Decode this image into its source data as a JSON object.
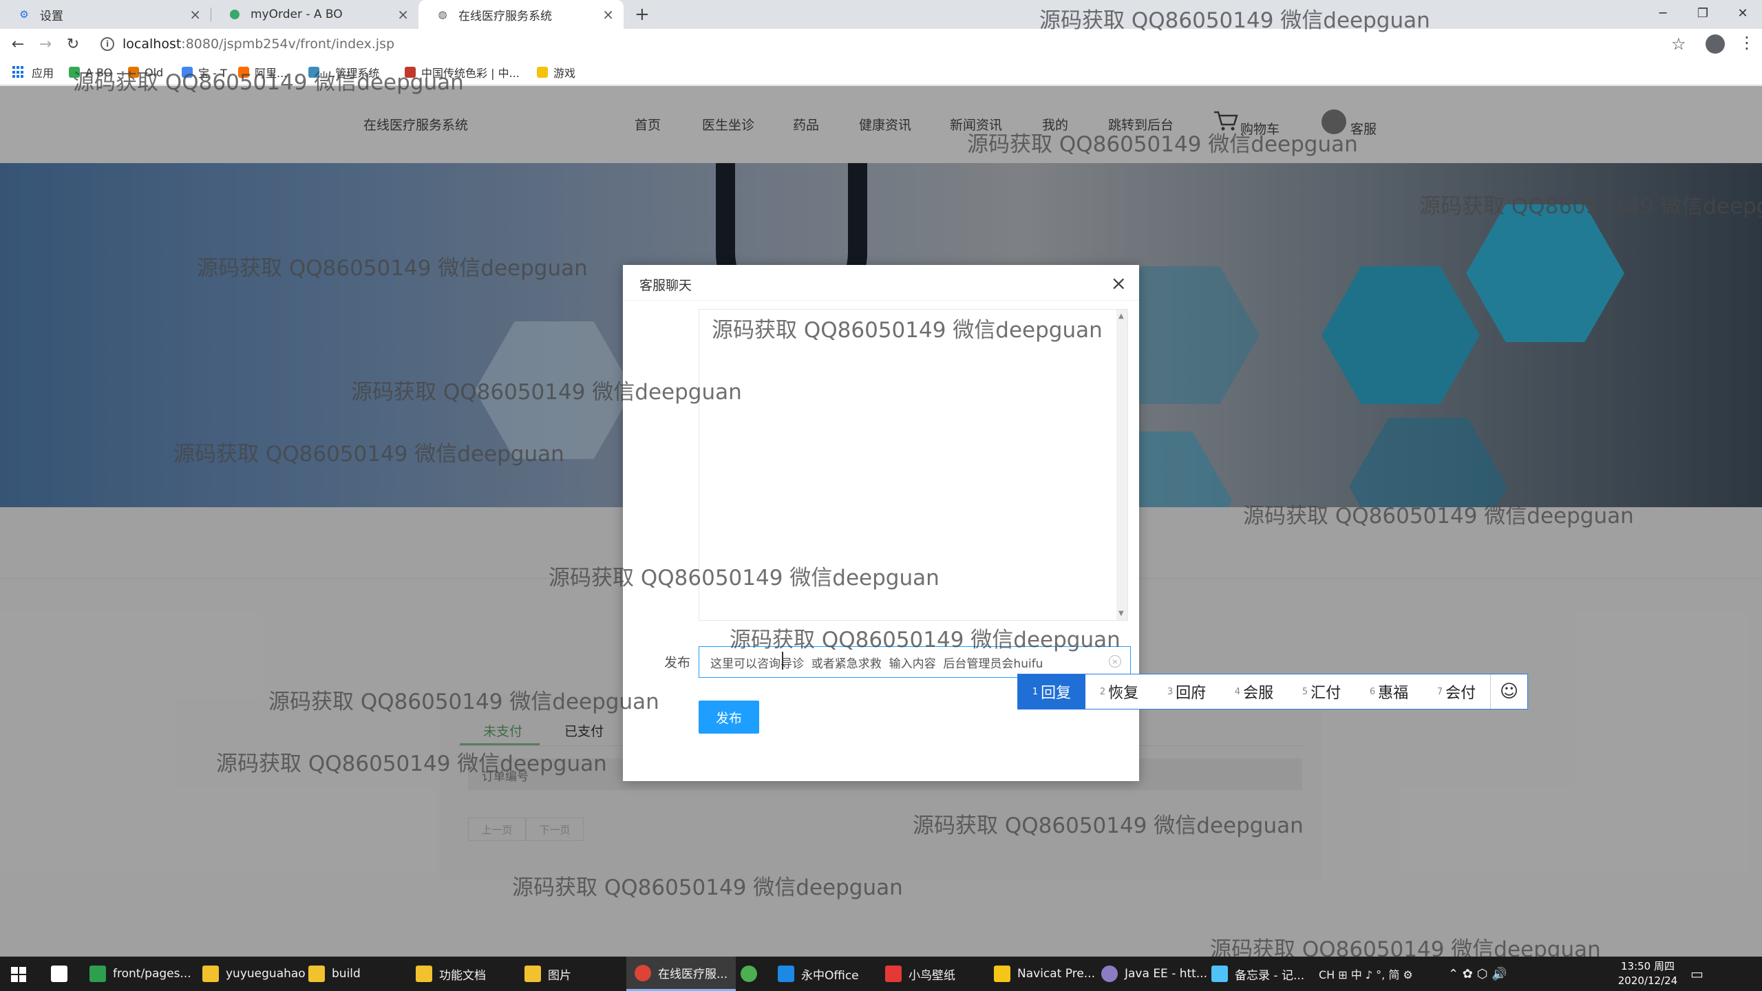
{
  "browser": {
    "tabs": [
      {
        "title": "设置",
        "icon": "gear-icon",
        "active": false
      },
      {
        "title": "myOrder - A BO",
        "icon": "app-icon",
        "active": false
      },
      {
        "title": "在线医疗服务系统",
        "icon": "globe-icon",
        "active": true
      }
    ],
    "new_tab_symbol": "+",
    "url_host": "localhost",
    "url_path": ":8080/jspmb254v/front/index.jsp",
    "bookmarks": [
      {
        "label": "应用",
        "color": "#1a73e8"
      },
      {
        "label": "A BO",
        "color": "#34a853"
      },
      {
        "label": "Old",
        "color": "#e37400"
      },
      {
        "label": "宝 - T",
        "color": "#4285f4"
      },
      {
        "label": "阿里...",
        "color": "#ff6a00"
      },
      {
        "label": "...管理系统",
        "color": "#3c8dbc"
      },
      {
        "label": "中国传统色彩 | 中...",
        "color": "#c0392b"
      },
      {
        "label": "游戏",
        "color": "#f4c20d"
      }
    ]
  },
  "site": {
    "logo": "在线医疗服务系统",
    "nav": [
      "首页",
      "医生坐诊",
      "药品",
      "健康资讯",
      "新闻资讯",
      "我的",
      "跳转到后台",
      "购物车",
      "客服"
    ],
    "order_tabs": [
      "未支付",
      "已支付"
    ],
    "order_header": "订单编号",
    "pager": [
      "上一页",
      "下一页"
    ]
  },
  "modal": {
    "title": "客服聊天",
    "close_symbol": "×",
    "send_label": "发布",
    "input_value": "这里可以咨询导诊  或者紧急求救  输入内容  后台管理员会huifu",
    "button_label": "发布"
  },
  "ime": {
    "candidates": [
      {
        "num": "1",
        "text": "回复"
      },
      {
        "num": "2",
        "text": "恢复"
      },
      {
        "num": "3",
        "text": "回府"
      },
      {
        "num": "4",
        "text": "会服"
      },
      {
        "num": "5",
        "text": "汇付"
      },
      {
        "num": "6",
        "text": "惠福"
      },
      {
        "num": "7",
        "text": "会付"
      }
    ],
    "emoji_symbol": "☺"
  },
  "taskbar": {
    "items": [
      {
        "label": "front/pages...",
        "color": "#2e9e4f",
        "active": false
      },
      {
        "label": "yuyueguahao",
        "color": "#f2c12e",
        "active": false
      },
      {
        "label": "build",
        "color": "#f2c12e",
        "active": false
      },
      {
        "label": "功能文档",
        "color": "#f2c12e",
        "active": false
      },
      {
        "label": "图片",
        "color": "#f2c12e",
        "active": false
      },
      {
        "label": "在线医疗服...",
        "color": "#db4437",
        "active": true
      },
      {
        "label": "永中Office",
        "color": "#1e88e5",
        "active": false
      },
      {
        "label": "小鸟壁纸",
        "color": "#e53935",
        "active": false
      },
      {
        "label": "Navicat Pre...",
        "color": "#f5c518",
        "active": false
      },
      {
        "label": "Java EE - htt...",
        "color": "#8e7cc3",
        "active": false
      },
      {
        "label": "备忘录 - 记...",
        "color": "#4fc3f7",
        "active": false
      }
    ],
    "tray_text": "CH ⊞ 中 ♪ °, 简 ⚙",
    "time": "13:50 周四",
    "date": "2020/12/24"
  },
  "watermark": "源码获取 QQ86050149 微信deepguan",
  "colors": {
    "accent": "#1e9fff",
    "ime_selected": "#1f6fd6",
    "taskbar": "#1c1c1c",
    "tab_active_green": "#5a9a66"
  }
}
